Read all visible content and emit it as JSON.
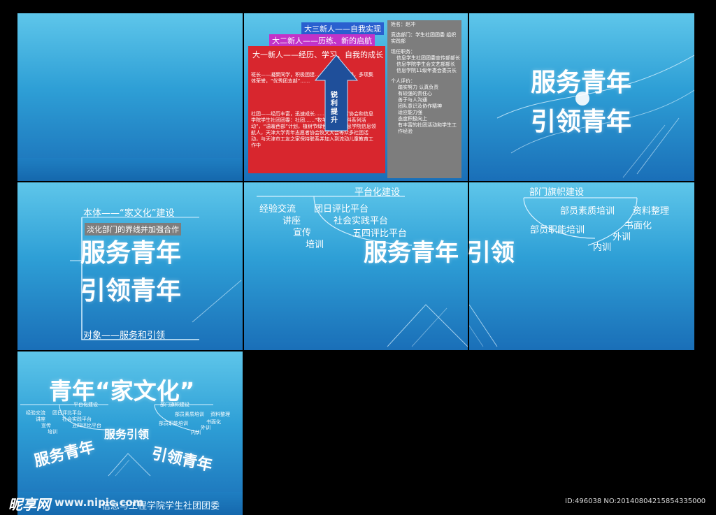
{
  "slide2": {
    "tag_red": "大一新人——经历、学习、自我的成长",
    "tag_magenta": "大二新人——历练、新的启航",
    "tag_blue": "大三新人——自我实现",
    "arrow_label": "锐利提升",
    "red_body_1": "班长——凝聚同学，积极团建……获得院级荣誉，多项集体荣誉，“优秀团支部”……",
    "red_body_2": "社团——经历丰富，迅速成长……青年志愿者协会和信息学院学生社团团委：社团……“牧羊地儿童材料系列活动”，“温暖西部”计划，植树节绿色文奖，信息学院信息领航人，天津大学青年志愿者协会牧文大会等众多社团活动，与天津市工友之家保持联系并加入到流动儿童教育工作中",
    "profile_name": "姓名：赵冲",
    "profile_dept": "竞选部门：学生社团团委 组织实践部",
    "profile_pos_title": "现任职务：",
    "profile_pos_1": "信息学生社团团委宣传部部长",
    "profile_pos_2": "信息学院学生会文艺部部长",
    "profile_pos_3": "信息学院11级年委会委员长",
    "profile_eval_title": "个人评价：",
    "profile_eval_1": "踏实努力 认真负责",
    "profile_eval_2": "有较强的责任心",
    "profile_eval_3": "善于与人沟通",
    "profile_eval_4": "团队意识及协作精神",
    "profile_eval_5": "适应能力强",
    "profile_eval_6": "态度积极向上",
    "profile_eval_7": "有丰富的社团活动和学生工作经验"
  },
  "slide3": {
    "line1": "服务青年",
    "line2": "引领青年"
  },
  "slide4": {
    "top": "本体——“家文化”建设",
    "sub": "淡化部门的界线并加强合作",
    "line1": "服务青年",
    "line2": "引领青年",
    "bottom": "对象——服务和引领"
  },
  "slide56": {
    "center": "服务青年 引领",
    "left_title": "平台化建设",
    "left_items": [
      "经验交流",
      "团日评比平台",
      "讲座",
      "社会实践平台",
      "宣传",
      "五四评比平台",
      "培训"
    ],
    "right_title": "部门旗帜建设",
    "right_items": [
      "部员素质培训",
      "资料整理",
      "部员职能培训",
      "书面化",
      "外训",
      "内训"
    ]
  },
  "slide7": {
    "title": "青年“家文化”",
    "center": "服务引领",
    "left_big": "服务青年",
    "right_big": "引领青年",
    "footer": "信息与工程学院学生社团团委"
  },
  "watermark": {
    "logo": "昵享网",
    "url": "www.nipic.com",
    "id": "ID:496038 NO:20140804215854335000"
  },
  "colors": {
    "red": "#d8262e",
    "magenta": "#c233c8",
    "blue": "#2a5fcf",
    "gray": "#7d7d7d"
  }
}
